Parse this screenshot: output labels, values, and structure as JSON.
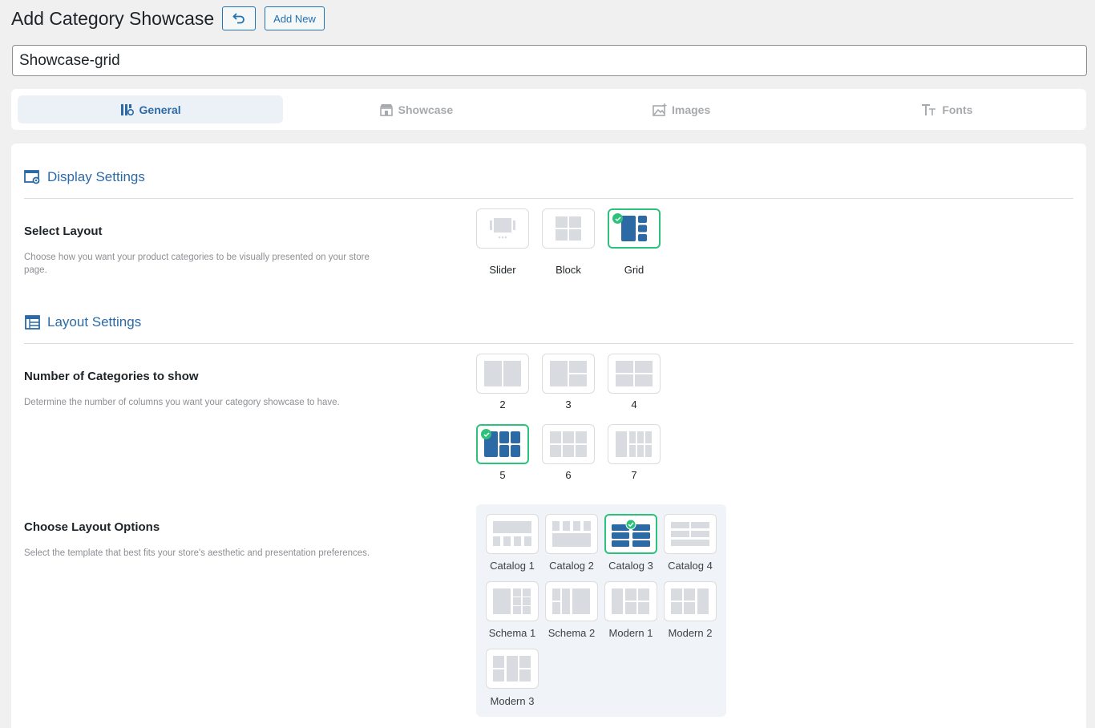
{
  "header": {
    "title": "Add Category Showcase",
    "undo_icon": "undo-icon",
    "add_new_label": "Add New"
  },
  "title_input": {
    "value": "Showcase-grid"
  },
  "tabs": [
    {
      "label": "General",
      "icon": "general-icon",
      "active": true
    },
    {
      "label": "Showcase",
      "icon": "store-icon",
      "active": false
    },
    {
      "label": "Images",
      "icon": "images-icon",
      "active": false
    },
    {
      "label": "Fonts",
      "icon": "fonts-icon",
      "active": false
    }
  ],
  "display_settings": {
    "heading": "Display Settings",
    "select_layout": {
      "label": "Select Layout",
      "description": "Choose how you want your product categories to be visually presented on your store page.",
      "options": [
        "Slider",
        "Block",
        "Grid"
      ],
      "selected": "Grid"
    }
  },
  "layout_settings": {
    "heading": "Layout Settings",
    "categories": {
      "label": "Number of Categories to show",
      "description": "Determine the number of columns you want your category showcase to have.",
      "options": [
        "2",
        "3",
        "4",
        "5",
        "6",
        "7"
      ],
      "selected": "5"
    },
    "layout_options": {
      "label": "Choose Layout Options",
      "description": "Select the template that best fits your store's aesthetic and presentation preferences.",
      "options": [
        "Catalog 1",
        "Catalog 2",
        "Catalog 3",
        "Catalog 4",
        "Schema 1",
        "Schema 2",
        "Modern 1",
        "Modern 2",
        "Modern 3"
      ],
      "selected": "Catalog 3"
    }
  },
  "colors": {
    "accent": "#2c6aa6",
    "selected_border": "#2dc27b",
    "placeholder": "#d8dbe0"
  }
}
